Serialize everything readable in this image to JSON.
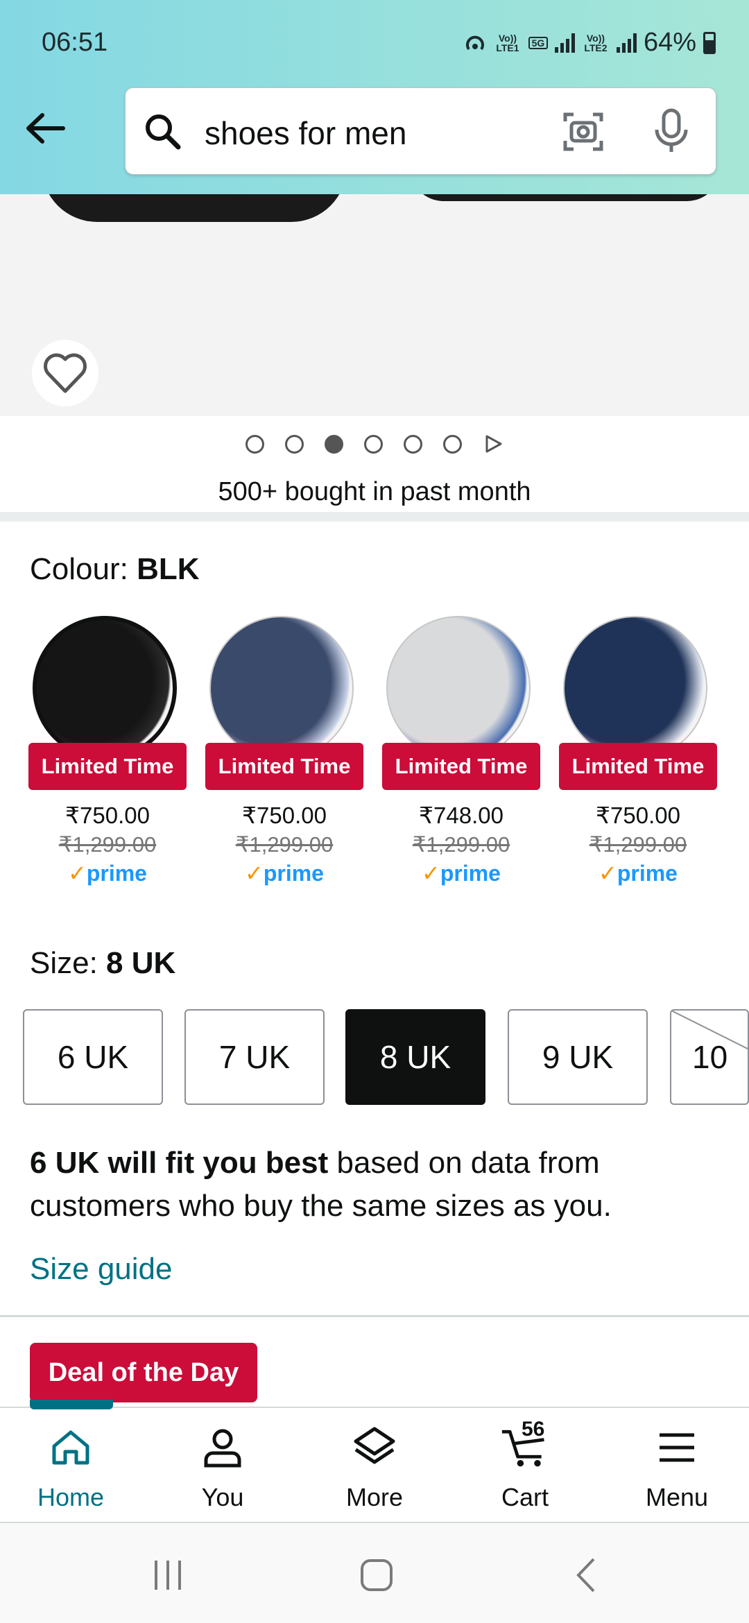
{
  "status_bar": {
    "time": "06:51",
    "sim1": "Vo)) LTE1",
    "network": "5G",
    "sim2": "Vo)) LTE2",
    "battery": "64%"
  },
  "search": {
    "query": "shoes for men"
  },
  "carousel": {
    "dot_count": 6,
    "active_index": 2
  },
  "bought_text": "500+ bought in past month",
  "colour": {
    "label": "Colour: ",
    "value": "BLK",
    "options": [
      {
        "badge": "Limited Time",
        "price": "₹750.00",
        "mrp": "₹1,299.00",
        "prime": "prime",
        "colors": [
          "#151515",
          "#2a2a2a"
        ]
      },
      {
        "badge": "Limited Time",
        "price": "₹750.00",
        "mrp": "₹1,299.00",
        "prime": "prime",
        "colors": [
          "#3a4a6b",
          "#c9d3e8"
        ]
      },
      {
        "badge": "Limited Time",
        "price": "₹748.00",
        "mrp": "₹1,299.00",
        "prime": "prime",
        "colors": [
          "#d9dadc",
          "#4a6fb0"
        ]
      },
      {
        "badge": "Limited Time",
        "price": "₹750.00",
        "mrp": "₹1,299.00",
        "prime": "prime",
        "colors": [
          "#1f3358",
          "#d6dde8"
        ]
      }
    ]
  },
  "size": {
    "label": "Size: ",
    "value": "8 UK",
    "options": [
      "6 UK",
      "7 UK",
      "8 UK",
      "9 UK",
      "10"
    ],
    "selected": "8 UK",
    "unavailable": "10"
  },
  "fit": {
    "bold": "6 UK will fit you best",
    "rest": " based on data from customers who buy the same sizes as you."
  },
  "size_guide": "Size guide",
  "deal_badge": "Deal of the Day",
  "bottom_nav": {
    "home": "Home",
    "you": "You",
    "more": "More",
    "cart": "Cart",
    "cart_count": "56",
    "menu": "Menu"
  },
  "colors": {
    "accent_teal": "#007185",
    "deal_red": "#cc0c39",
    "prime_blue": "#1a98ff",
    "prime_check": "#f79400"
  }
}
